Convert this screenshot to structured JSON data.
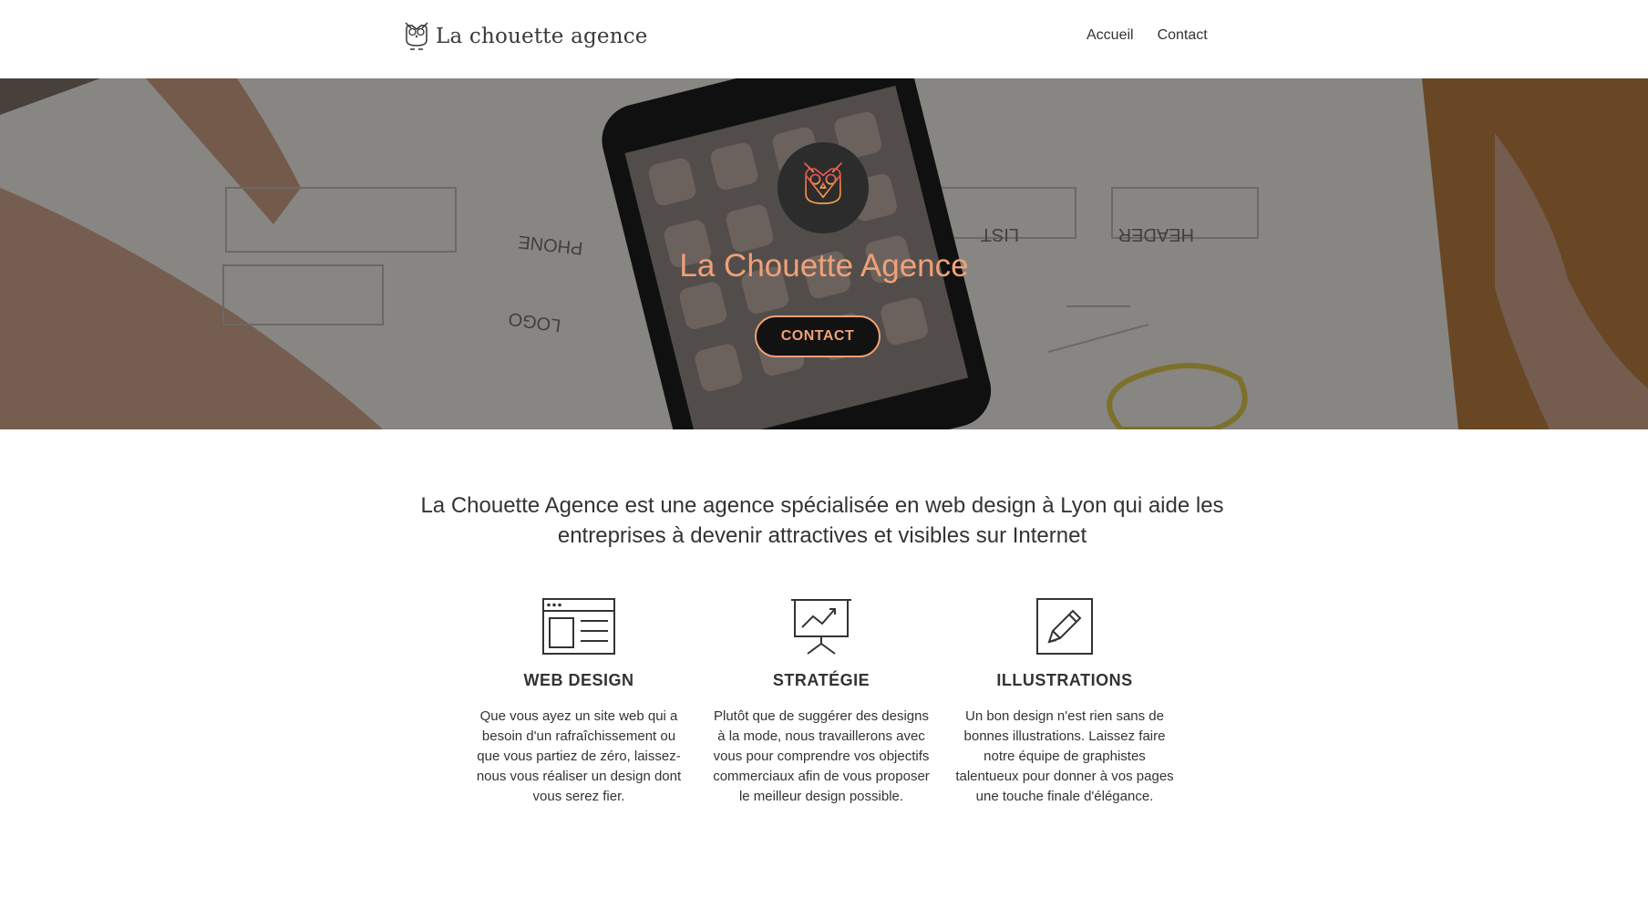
{
  "navbar": {
    "brand": "La chouette agence",
    "links": [
      {
        "label": "Accueil"
      },
      {
        "label": "Contact"
      }
    ]
  },
  "hero": {
    "title": "La Chouette Agence",
    "cta_label": "CONTACT",
    "accent_color": "#f0a077",
    "sketch_texts": [
      "PHONE",
      "LIST",
      "HEADER",
      "LOGO"
    ]
  },
  "intro": {
    "text": "La Chouette Agence est une agence spécialisée en web design à Lyon qui aide les entreprises à devenir attractives et visibles sur Internet"
  },
  "services": [
    {
      "icon": "browser-window-icon",
      "title": "WEB DESIGN",
      "text": "Que vous ayez un site web qui a besoin d'un rafraîchissement ou que vous partiez de zéro, laissez-nous vous réaliser un design dont vous serez fier."
    },
    {
      "icon": "presentation-chart-icon",
      "title": "STRATÉGIE",
      "text": "Plutôt que de suggérer des designs à la mode, nous travaillerons avec vous pour comprendre vos objectifs commerciaux afin de vous proposer le meilleur design possible."
    },
    {
      "icon": "pencil-edit-icon",
      "title": "ILLUSTRATIONS",
      "text": "Un bon design n'est rien sans de bonnes illustrations. Laissez faire notre équipe de graphistes talentueux pour donner à vos pages une touche finale d'élégance."
    }
  ]
}
